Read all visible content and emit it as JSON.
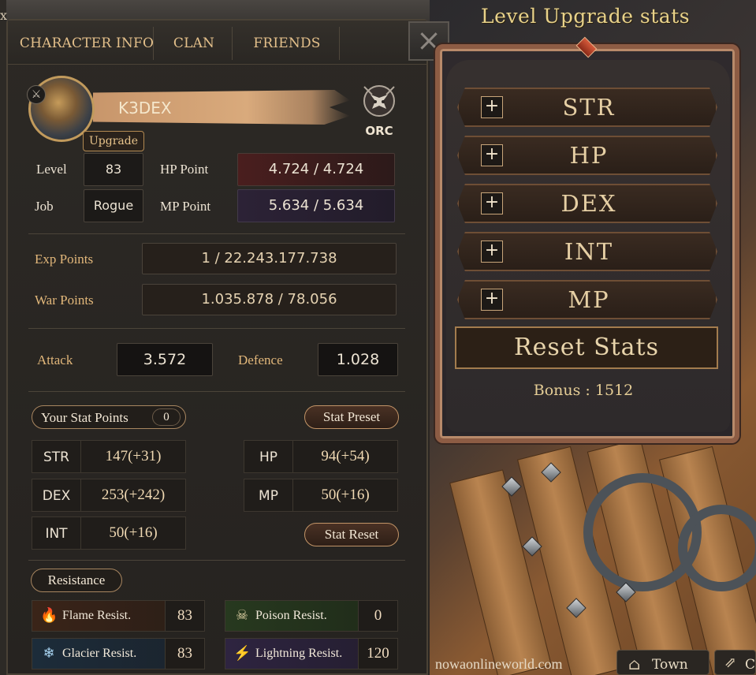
{
  "window": {
    "corner_label": "x"
  },
  "tabs": [
    {
      "label": "CHARACTER INFO"
    },
    {
      "label": "CLAN"
    },
    {
      "label": "FRIENDS"
    }
  ],
  "close_icon": "×",
  "character": {
    "name": "K3DEX",
    "upgrade_label": "Upgrade",
    "race": "ORC",
    "level_label": "Level",
    "level": "83",
    "job_label": "Job",
    "job": "Rogue",
    "hp_label": "HP Point",
    "hp": "4.724 / 4.724",
    "mp_label": "MP Point",
    "mp": "5.634 / 5.634",
    "exp_label": "Exp Points",
    "exp": "1 / 22.243.177.738",
    "war_label": "War Points",
    "war": "1.035.878 / 78.056",
    "attack_label": "Attack",
    "attack": "3.572",
    "defence_label": "Defence",
    "defence": "1.028"
  },
  "stats": {
    "points_label": "Your Stat Points",
    "points": "0",
    "preset_label": "Stat Preset",
    "reset_label": "Stat Reset",
    "str_name": "STR",
    "str_val": "147(+31)",
    "dex_name": "DEX",
    "dex_val": "253(+242)",
    "int_name": "INT",
    "int_val": "50(+16)",
    "hp_name": "HP",
    "hp_val": "94(+54)",
    "mp_name": "MP",
    "mp_val": "50(+16)"
  },
  "resistance": {
    "label": "Resistance",
    "flame_label": "Flame Resist.",
    "flame": "83",
    "poison_label": "Poison Resist.",
    "poison": "0",
    "glacier_label": "Glacier Resist.",
    "glacier": "83",
    "lightning_label": "Lightning Resist.",
    "lightning": "120"
  },
  "upgrade_panel": {
    "title": "Level Upgrade stats",
    "plus": "+",
    "rows": [
      "STR",
      "HP",
      "DEX",
      "INT",
      "MP"
    ],
    "reset_label": "Reset Stats",
    "bonus": "Bonus : 1512"
  },
  "footer": {
    "url": "nowaonlineworld.com",
    "town_label": "Town",
    "ext_label": "C"
  },
  "icons": {
    "flame": "flame-icon",
    "poison": "skull-icon",
    "glacier": "snowflake-icon",
    "lightning": "lightning-icon"
  }
}
